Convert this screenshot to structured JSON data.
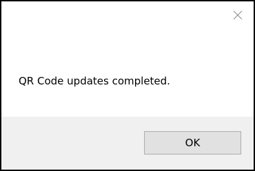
{
  "dialog": {
    "message": "QR Code updates completed.",
    "ok_label": "OK",
    "close_icon": "close-icon"
  },
  "colors": {
    "background": "#ffffff",
    "footer": "#f0f0f0",
    "button_face": "#e1e1e1",
    "button_border": "#adadad",
    "close_glyph": "#8a8a8a"
  }
}
